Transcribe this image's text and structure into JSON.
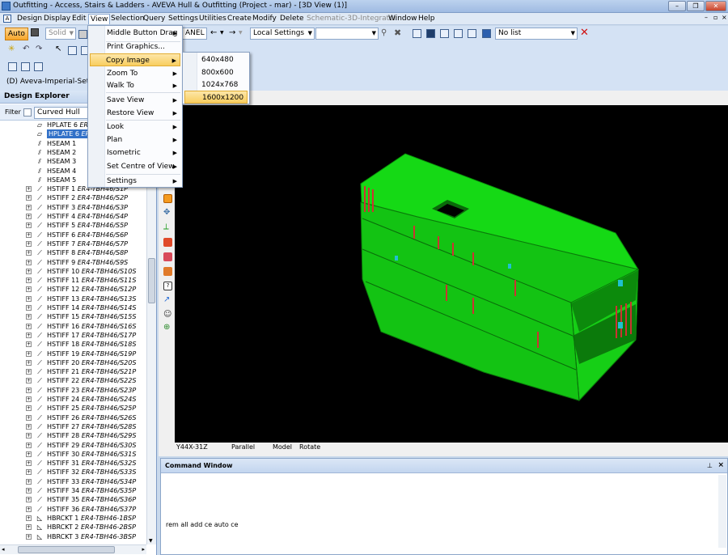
{
  "window": {
    "title": "Outfitting - Access, Stairs & Ladders -  AVEVA Hull & Outfitting (Project - mar) - [3D View (1)]"
  },
  "menubar": [
    "Design",
    "Display",
    "Edit",
    "View",
    "Selection",
    "Query",
    "Settings",
    "Utilities",
    "Create",
    "Modify",
    "Delete",
    "Schematic-3D-Integrator",
    "Window",
    "Help"
  ],
  "toolbar": {
    "auto_label": "Auto",
    "solid_label": "Solid",
    "panel_combo": "ANEL",
    "local_settings": "Local Settings",
    "no_list": "No list",
    "project_label": "(D) Aveva-Imperial-Setting"
  },
  "view_menu": {
    "items": [
      "Middle Button Drag",
      "Print Graphics...",
      "Copy Image",
      "Zoom To",
      "Walk To",
      "Save View",
      "Restore View",
      "Look",
      "Plan",
      "Isometric",
      "Set Centre of View",
      "Settings"
    ],
    "copy_image_sub": [
      "640x480",
      "800x600",
      "1024x768",
      "1600x1200"
    ]
  },
  "explorer": {
    "header": "Design Explorer",
    "filter_label": "Filter",
    "filter_value": "Curved Hull",
    "rows": [
      {
        "name": "HPLATE 6",
        "ref": "ER"
      },
      {
        "name": "HPLATE 6",
        "ref": "ER",
        "selected": true
      },
      {
        "name": "HSEAM 1",
        "ref": ""
      },
      {
        "name": "HSEAM 2",
        "ref": ""
      },
      {
        "name": "HSEAM 3",
        "ref": ""
      },
      {
        "name": "HSEAM 4",
        "ref": ""
      },
      {
        "name": "HSEAM 5",
        "ref": ""
      },
      {
        "name": "HSTIFF 1",
        "ref": "ER4-TBH46/S1P"
      },
      {
        "name": "HSTIFF 2",
        "ref": "ER4-TBH46/S2P"
      },
      {
        "name": "HSTIFF 3",
        "ref": "ER4-TBH46/S3P"
      },
      {
        "name": "HSTIFF 4",
        "ref": "ER4-TBH46/S4P"
      },
      {
        "name": "HSTIFF 5",
        "ref": "ER4-TBH46/S5P"
      },
      {
        "name": "HSTIFF 6",
        "ref": "ER4-TBH46/S6P"
      },
      {
        "name": "HSTIFF 7",
        "ref": "ER4-TBH46/S7P"
      },
      {
        "name": "HSTIFF 8",
        "ref": "ER4-TBH46/S8P"
      },
      {
        "name": "HSTIFF 9",
        "ref": "ER4-TBH46/S9S"
      },
      {
        "name": "HSTIFF 10",
        "ref": "ER4-TBH46/S10S"
      },
      {
        "name": "HSTIFF 11",
        "ref": "ER4-TBH46/S11S"
      },
      {
        "name": "HSTIFF 12",
        "ref": "ER4-TBH46/S12P"
      },
      {
        "name": "HSTIFF 13",
        "ref": "ER4-TBH46/S13S"
      },
      {
        "name": "HSTIFF 14",
        "ref": "ER4-TBH46/S14S"
      },
      {
        "name": "HSTIFF 15",
        "ref": "ER4-TBH46/S15S"
      },
      {
        "name": "HSTIFF 16",
        "ref": "ER4-TBH46/S16S"
      },
      {
        "name": "HSTIFF 17",
        "ref": "ER4-TBH46/S17P"
      },
      {
        "name": "HSTIFF 18",
        "ref": "ER4-TBH46/S18S"
      },
      {
        "name": "HSTIFF 19",
        "ref": "ER4-TBH46/S19P"
      },
      {
        "name": "HSTIFF 20",
        "ref": "ER4-TBH46/S20S"
      },
      {
        "name": "HSTIFF 21",
        "ref": "ER4-TBH46/S21P"
      },
      {
        "name": "HSTIFF 22",
        "ref": "ER4-TBH46/S22S"
      },
      {
        "name": "HSTIFF 23",
        "ref": "ER4-TBH46/S23P"
      },
      {
        "name": "HSTIFF 24",
        "ref": "ER4-TBH46/S24S"
      },
      {
        "name": "HSTIFF 25",
        "ref": "ER4-TBH46/S25P"
      },
      {
        "name": "HSTIFF 26",
        "ref": "ER4-TBH46/S26S"
      },
      {
        "name": "HSTIFF 27",
        "ref": "ER4-TBH46/S28S"
      },
      {
        "name": "HSTIFF 28",
        "ref": "ER4-TBH46/S29S"
      },
      {
        "name": "HSTIFF 29",
        "ref": "ER4-TBH46/S30S"
      },
      {
        "name": "HSTIFF 30",
        "ref": "ER4-TBH46/S31S"
      },
      {
        "name": "HSTIFF 31",
        "ref": "ER4-TBH46/S32S"
      },
      {
        "name": "HSTIFF 32",
        "ref": "ER4-TBH46/S33S"
      },
      {
        "name": "HSTIFF 33",
        "ref": "ER4-TBH46/S34P"
      },
      {
        "name": "HSTIFF 34",
        "ref": "ER4-TBH46/S35P"
      },
      {
        "name": "HSTIFF 35",
        "ref": "ER4-TBH46/S36P"
      },
      {
        "name": "HSTIFF 36",
        "ref": "ER4-TBH46/S37P"
      },
      {
        "name": "HBRCKT 1",
        "ref": "ER4-TBH46-1BSP"
      },
      {
        "name": "HBRCKT 2",
        "ref": "ER4-TBH46-2BSP"
      },
      {
        "name": "HBRCKT 3",
        "ref": "ER4-TBH46-3BSP"
      }
    ]
  },
  "view_status": [
    "Y44X-31Z",
    "Parallel",
    "Model",
    "Rotate"
  ],
  "command_window": {
    "title": "Command Window",
    "last_command": "rem all add ce auto ce"
  },
  "colors": {
    "hull": "#18e018",
    "canvas": "#000000",
    "selection": "#3271c8",
    "menu_highlight": "#f8cd5f"
  }
}
